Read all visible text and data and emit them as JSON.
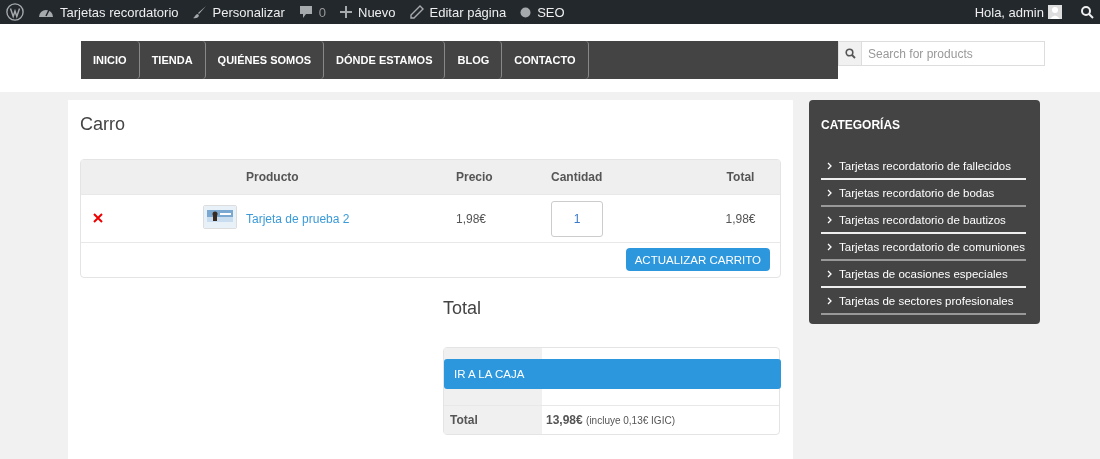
{
  "admin_bar": {
    "items": [
      {
        "kind": "logo"
      },
      {
        "kind": "dashboard",
        "label": "Tarjetas recordatorio"
      },
      {
        "kind": "brush",
        "label": "Personalizar"
      },
      {
        "kind": "comment",
        "label": "0"
      },
      {
        "kind": "plus",
        "label": "Nuevo"
      },
      {
        "kind": "pencil",
        "label": "Editar página"
      },
      {
        "kind": "dot",
        "label": "SEO"
      }
    ],
    "greeting": "Hola, admin"
  },
  "nav": {
    "items": [
      "INICIO",
      "TIENDA",
      "QUIÉNES SOMOS",
      "DÓNDE ESTAMOS",
      "BLOG",
      "CONTACTO"
    ]
  },
  "search": {
    "placeholder": "Search for products"
  },
  "page_title": "Carro",
  "cart": {
    "columns": [
      "Producto",
      "Precio",
      "Cantidad",
      "Total"
    ],
    "rows": [
      {
        "product": "Tarjeta de prueba 2",
        "price": "1,98€",
        "quantity": "1",
        "total": "1,98€"
      }
    ],
    "update_button": "ACTUALIZAR CARRITO"
  },
  "totals": {
    "title": "Total",
    "checkout_button": "IR A LA CAJA",
    "total_label": "Total",
    "total_value": "13,98€",
    "total_note": "(incluye 0,13€ IGIC)"
  },
  "sidebar": {
    "title": "CATEGORÍAS",
    "items": [
      "Tarjetas recordatorio de fallecidos",
      "Tarjetas recordatorio de bodas",
      "Tarjetas recordatorio de bautizos",
      "Tarjetas recordatorio de comuniones",
      "Tarjetas de ocasiones especiales",
      "Tarjetas de sectores profesionales"
    ]
  }
}
